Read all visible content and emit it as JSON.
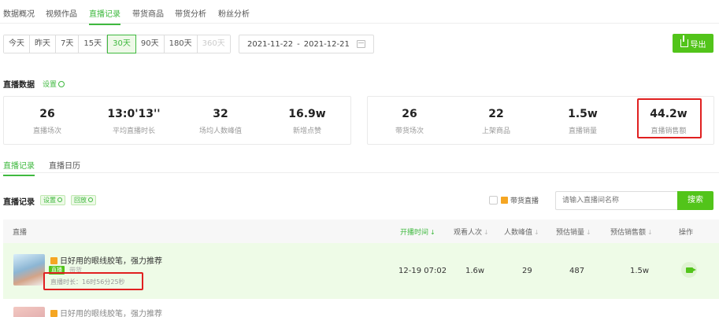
{
  "top_tabs": [
    "数据概况",
    "视频作品",
    "直播记录",
    "带货商品",
    "带货分析",
    "粉丝分析"
  ],
  "active_top_tab": "直播记录",
  "range_buttons": [
    "今天",
    "昨天",
    "7天",
    "15天",
    "30天",
    "90天",
    "180天",
    "360天"
  ],
  "active_range": "30天",
  "date_range": {
    "start": "2021-11-22",
    "separator": "-",
    "end": "2021-12-21"
  },
  "export_label": "导出",
  "live_data": {
    "title": "直播数据",
    "settings_label": "设置",
    "left_stats": [
      {
        "value": "26",
        "label": "直播场次"
      },
      {
        "value": "13:0'13''",
        "label": "平均直播时长"
      },
      {
        "value": "32",
        "label": "场均人数峰值"
      },
      {
        "value": "16.9w",
        "label": "新增点赞"
      }
    ],
    "right_stats": [
      {
        "value": "26",
        "label": "带货场次"
      },
      {
        "value": "22",
        "label": "上架商品"
      },
      {
        "value": "1.5w",
        "label": "直播销量"
      },
      {
        "value": "44.2w",
        "label": "直播销售额"
      }
    ]
  },
  "sub_tabs": [
    "直播记录",
    "直播日历"
  ],
  "active_sub_tab": "直播记录",
  "records": {
    "title": "直播记录",
    "tag_settings": "设置",
    "tag_reset": "回放",
    "filter_label": "带货直播",
    "search_placeholder": "请输入直播间名称",
    "search_button": "搜索",
    "columns": {
      "live": "直播",
      "start_time": "开播时间",
      "viewers": "观看人次",
      "peak": "人数峰值",
      "est_sales": "预估销量",
      "est_revenue": "预估销售额",
      "action": "操作"
    },
    "rows": [
      {
        "title": "日好用的眼线胶笔，强力推荐",
        "tag": "直播",
        "sub": "带货",
        "duration": "直播时长：16时56分25秒",
        "start_time": "12-19 07:02",
        "viewers": "1.6w",
        "peak": "29",
        "est_sales": "487",
        "est_revenue": "1.5w"
      }
    ],
    "next_row_title": "日好用的眼线胶笔，强力推荐"
  },
  "colors": {
    "accent": "#52c41a",
    "highlight": "#e02020"
  }
}
